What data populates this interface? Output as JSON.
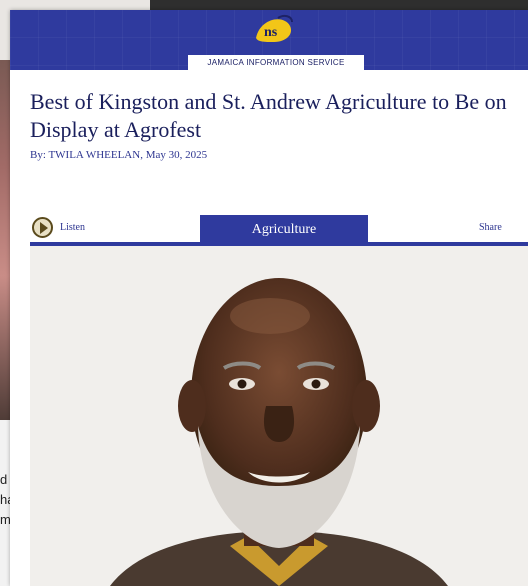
{
  "background": {
    "text_fragments": [
      "d ,",
      "ha",
      "m"
    ]
  },
  "header": {
    "logo_icon": "jis-logo-icon",
    "service_name": "JAMAICA INFORMATION SERVICE",
    "banner_color": "#2f3a9e"
  },
  "article": {
    "title": "Best of Kingston and St. Andrew Agriculture to Be on Display at Agrofest",
    "byline": "By: TWILA WHEELAN, May 30, 2025"
  },
  "toolbar": {
    "listen_label": "Listen",
    "listen_icon": "play-circle-icon",
    "category": "Agriculture",
    "share_label": "Share"
  },
  "colors": {
    "accent": "#2f3a9e",
    "title": "#1a1f5c",
    "link": "#2d3590"
  }
}
